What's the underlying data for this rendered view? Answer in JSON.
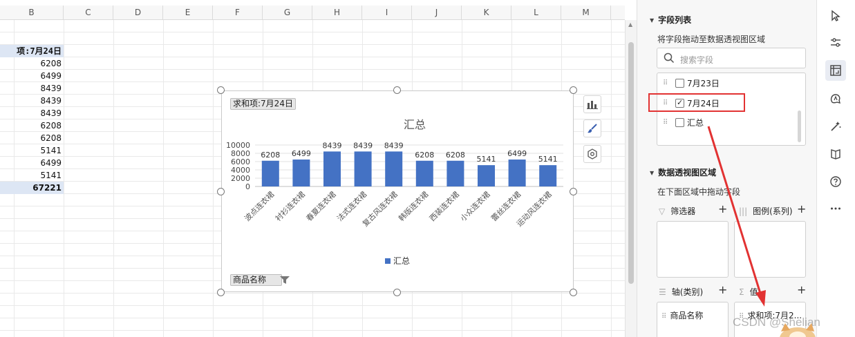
{
  "sheet": {
    "columns": [
      "B",
      "C",
      "D",
      "E",
      "F",
      "G",
      "H",
      "I",
      "J",
      "K",
      "L",
      "M"
    ],
    "header_cell": "项:7月24日",
    "values": [
      "6208",
      "6499",
      "8439",
      "8439",
      "8439",
      "6208",
      "6208",
      "5141",
      "6499",
      "5141"
    ],
    "total": "67221"
  },
  "chart": {
    "field_button_top": "求和项:7月24日",
    "field_button_bottom": "商品名称",
    "legend_label": "汇总"
  },
  "chart_data": {
    "type": "bar",
    "title": "汇总",
    "categories": [
      "波点连衣裙",
      "衬衫连衣裙",
      "春夏连衣裙",
      "法式连衣裙",
      "复古风连衣裙",
      "韩版连衣裙",
      "西装连衣裙",
      "小众连衣裙",
      "蕾丝连衣裙",
      "运动风连衣裙"
    ],
    "series": [
      {
        "name": "汇总",
        "values": [
          6208,
          6499,
          8439,
          8439,
          8439,
          6208,
          6208,
          5141,
          6499,
          5141
        ]
      }
    ],
    "ylim": [
      0,
      10000
    ],
    "yticks": [
      "0",
      "2000",
      "4000",
      "6000",
      "8000",
      "10000"
    ],
    "grid": true,
    "legend": "bottom",
    "color": "#4472c4"
  },
  "panel": {
    "field_list_title": "字段列表",
    "drag_hint": "将字段拖动至数据透视图区域",
    "search_placeholder": "搜索字段",
    "fields": [
      {
        "label": "7月23日",
        "checked": false
      },
      {
        "label": "7月24日",
        "checked": true
      },
      {
        "label": "汇总",
        "checked": false
      }
    ],
    "area_title": "数据透视图区域",
    "area_hint": "在下面区域中拖动字段",
    "areas": {
      "filter": {
        "label": "筛选器",
        "item": ""
      },
      "legend": {
        "label": "图例(系列)",
        "item": ""
      },
      "axis": {
        "label": "轴(类别)",
        "item": "商品名称"
      },
      "values": {
        "label": "值",
        "item": "求和项:7月2..."
      }
    }
  },
  "toolbar": [
    "cursor-icon",
    "sliders-icon",
    "pivot-icon",
    "ai-icon",
    "magic-wand-icon",
    "book-icon",
    "help-icon",
    "more-icon"
  ],
  "watermark": "CSDN @Shelian",
  "colors": {
    "accent": "#4472c4",
    "highlight": "#e23232"
  }
}
